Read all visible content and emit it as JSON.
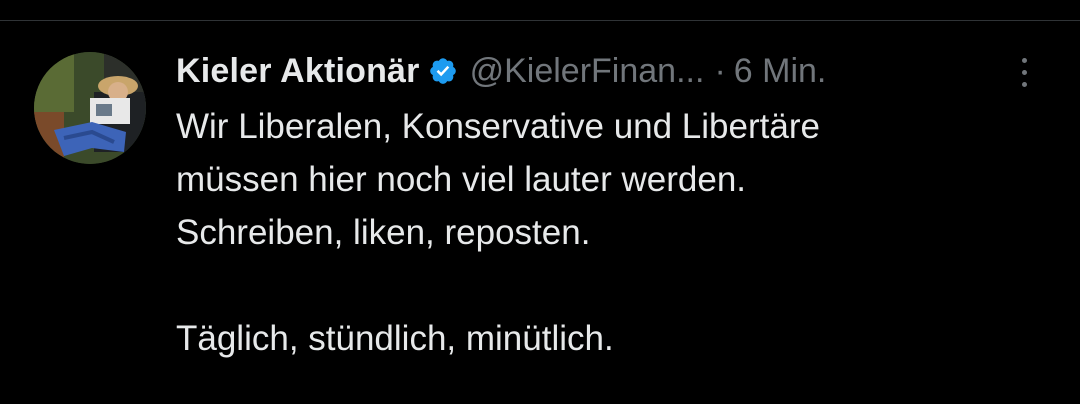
{
  "tweet": {
    "author_name": "Kieler Aktionär",
    "handle": "@KielerFinan...",
    "separator": "·",
    "timestamp": "6 Min.",
    "text": "Wir Liberalen, Konservative und Libertäre\nmüssen hier noch viel lauter werden.\nSchreiben, liken, reposten.\n\nTäglich, stündlich, minütlich.",
    "verified_icon": "verified-badge-icon",
    "more_icon": "more-options-icon"
  },
  "colors": {
    "background": "#000000",
    "primary_text": "#e7e9ea",
    "secondary_text": "#71767b",
    "verified_blue": "#1d9bf0",
    "divider": "#2f3336"
  }
}
